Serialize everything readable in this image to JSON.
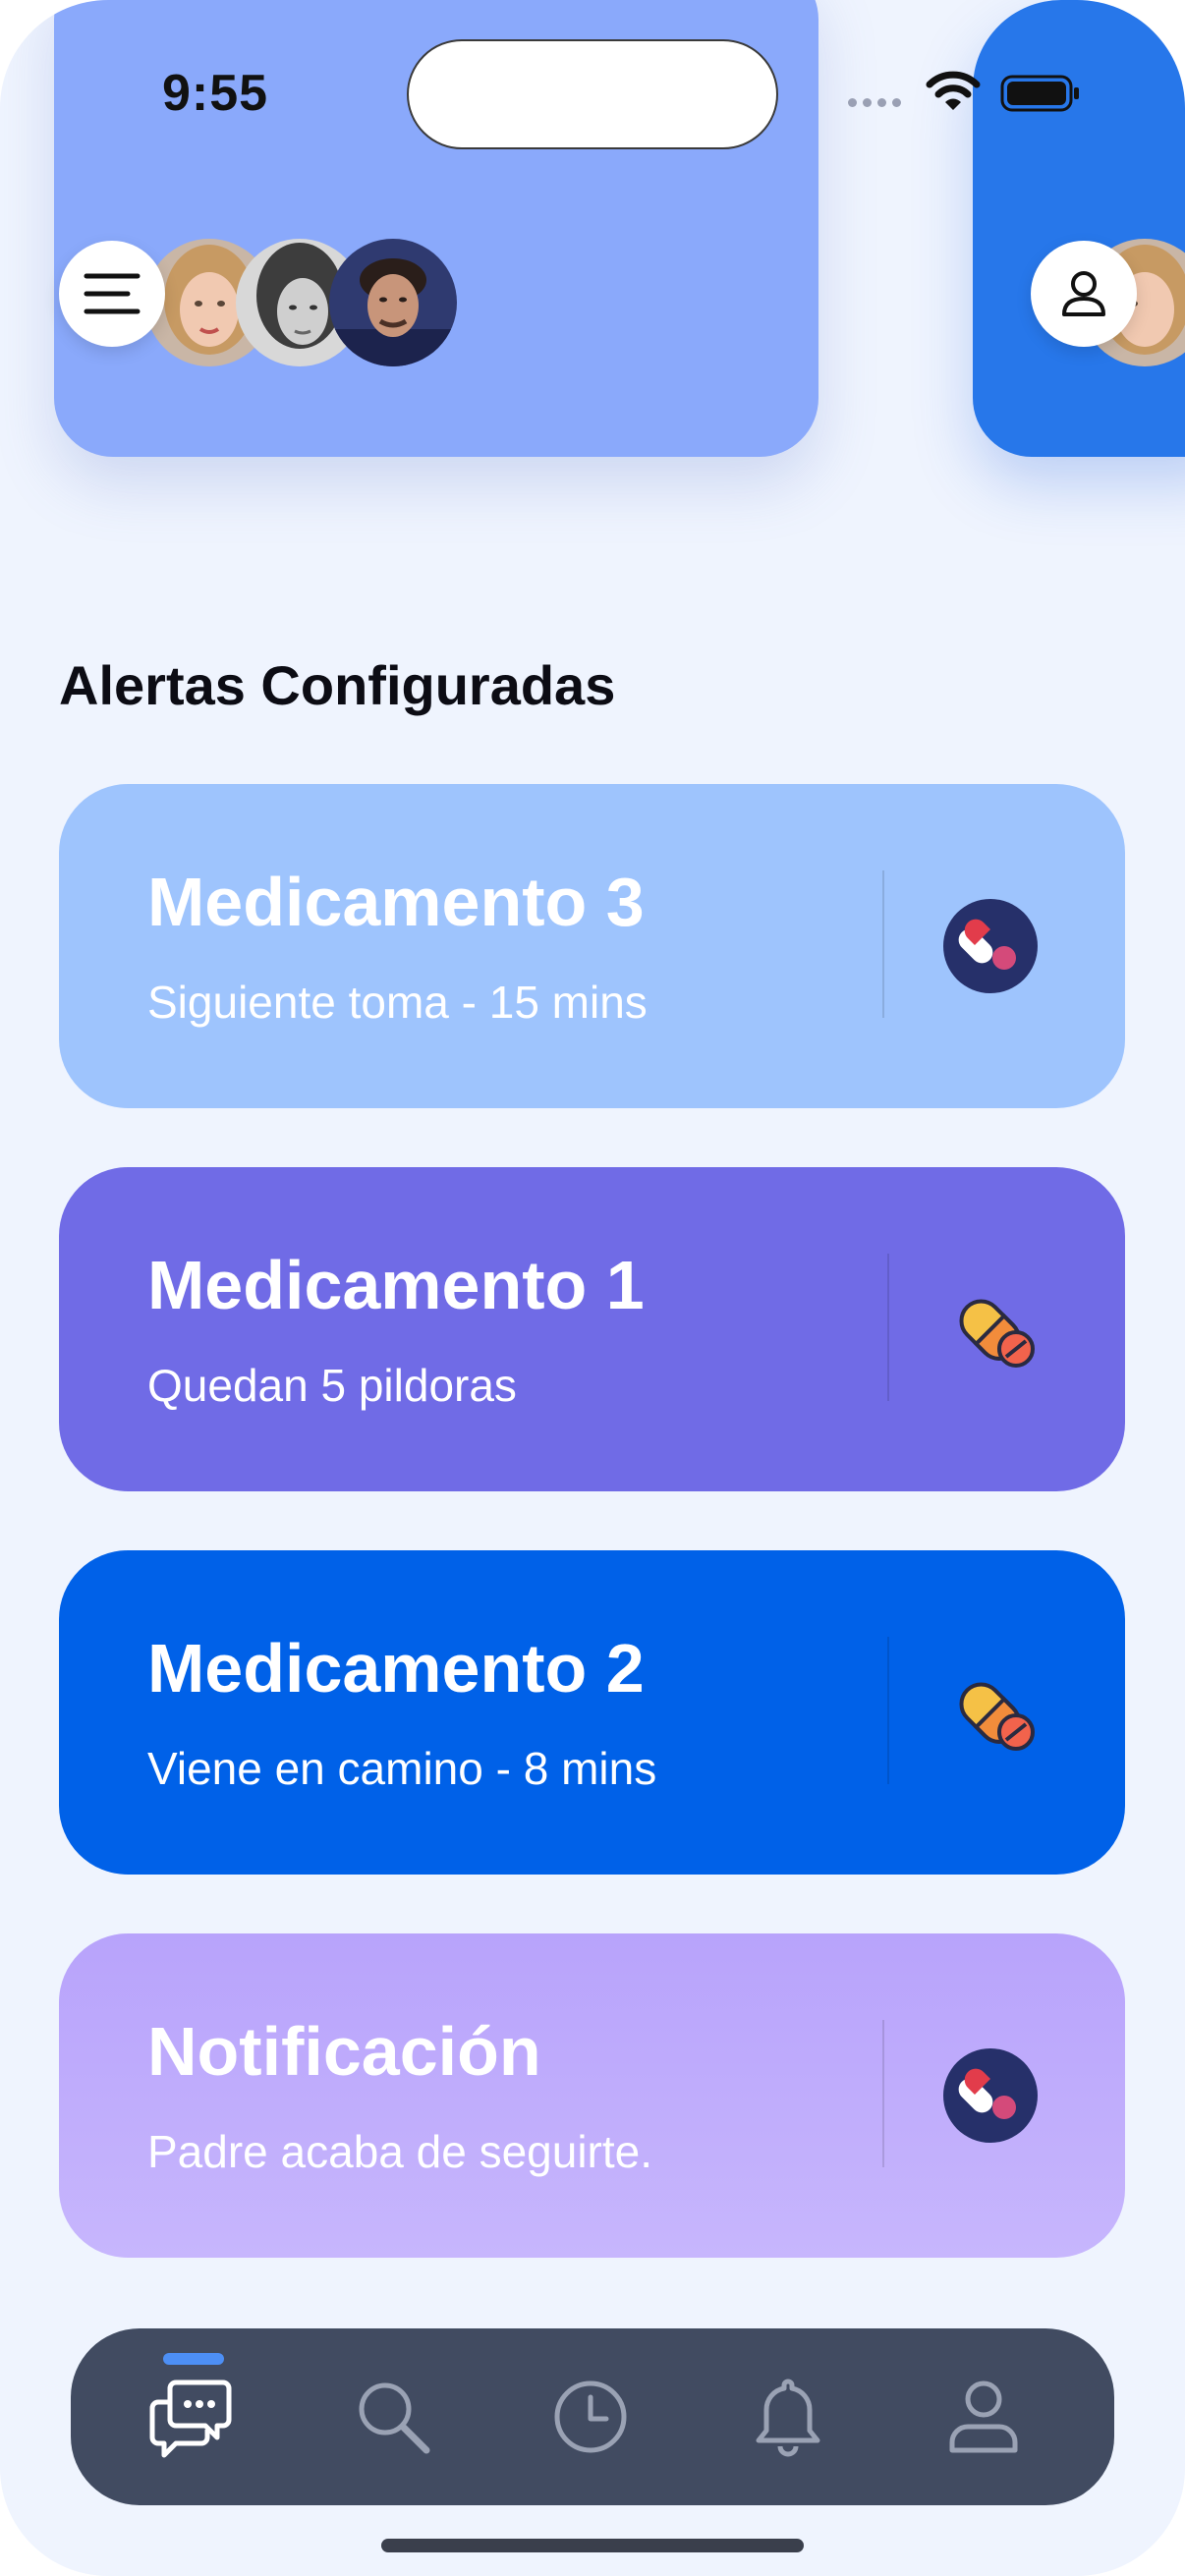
{
  "status_bar": {
    "time": "9:55"
  },
  "header": {
    "menu_icon": "hamburger-menu-icon",
    "profile_icon": "user-icon",
    "avatars": [
      "avatar-1",
      "avatar-2",
      "avatar-3"
    ]
  },
  "section": {
    "title": "Alertas Configuradas"
  },
  "cards": [
    {
      "title": "Medicamento 3",
      "subtitle": "Siguiente toma - 15 mins",
      "icon": "pills-icon",
      "color": "#9ec4fd"
    },
    {
      "title": "Medicamento 1",
      "subtitle": "Quedan 5 pildoras",
      "icon": "capsule-icon",
      "color": "#706be6"
    },
    {
      "title": "Medicamento 2",
      "subtitle": "Viene en camino - 8 mins",
      "icon": "capsule-icon",
      "color": "#0061e8"
    },
    {
      "title": "Notificación",
      "subtitle": "Padre acaba de seguirte.",
      "icon": "pills-icon",
      "color": "#b8a5fb"
    }
  ],
  "tabbar": {
    "tabs": [
      "chat-icon",
      "search-icon",
      "clock-icon",
      "bell-icon",
      "user-icon"
    ],
    "active_index": 0
  }
}
